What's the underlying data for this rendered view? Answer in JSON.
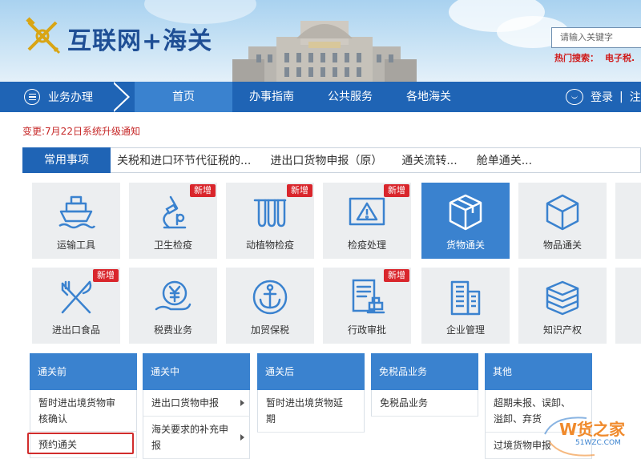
{
  "header": {
    "site_title": "互联网+海关",
    "search_placeholder": "请输入关键字",
    "hot_search_label": "热门搜索：",
    "hot_search_keyword": "电子税."
  },
  "nav": {
    "business_label": "业务办理",
    "items": [
      {
        "label": "首页",
        "active": true
      },
      {
        "label": "办事指南",
        "active": false
      },
      {
        "label": "公共服务",
        "active": false
      },
      {
        "label": "各地海关",
        "active": false
      }
    ],
    "login_label": "登录",
    "separator": "|",
    "register_label": "注"
  },
  "notice": "变更:7月22日系统升级通知",
  "tabbar": {
    "active_label": "常用事项",
    "links": [
      "关税和进口环节代征税的...",
      "进出口货物申报（原）",
      "通关流转...",
      "舱单通关..."
    ]
  },
  "tiles": [
    {
      "label": "运输工具",
      "icon": "ship-icon",
      "badge": ""
    },
    {
      "label": "卫生检疫",
      "icon": "microscope-icon",
      "badge": "新增"
    },
    {
      "label": "动植物检疫",
      "icon": "test-tubes-icon",
      "badge": "新增"
    },
    {
      "label": "检疫处理",
      "icon": "warning-sign-icon",
      "badge": "新增"
    },
    {
      "label": "货物通关",
      "icon": "cargo-box-icon",
      "badge": "",
      "active": true
    },
    {
      "label": "物品通关",
      "icon": "cube-icon",
      "badge": ""
    },
    {
      "label": "进出口食品",
      "icon": "fork-knife-icon",
      "badge": "新增"
    },
    {
      "label": "税费业务",
      "icon": "yuan-coin-hand-icon",
      "badge": ""
    },
    {
      "label": "加贸保税",
      "icon": "anchor-icon",
      "badge": ""
    },
    {
      "label": "行政审批",
      "icon": "document-stamp-icon",
      "badge": "新增"
    },
    {
      "label": "企业管理",
      "icon": "building-icon",
      "badge": ""
    },
    {
      "label": "知识产权",
      "icon": "books-icon",
      "badge": ""
    }
  ],
  "columns": [
    {
      "title": "通关前",
      "items": [
        {
          "label": "暂时进出境货物审核确认",
          "arrow": false
        },
        {
          "label": "预约通关",
          "arrow": false
        }
      ]
    },
    {
      "title": "通关中",
      "items": [
        {
          "label": "进出口货物申报",
          "arrow": true
        },
        {
          "label": "海关要求的补充申报",
          "arrow": true
        }
      ]
    },
    {
      "title": "通关后",
      "items": [
        {
          "label": "暂时进出境货物延期",
          "arrow": false
        }
      ]
    },
    {
      "title": "免税品业务",
      "items": [
        {
          "label": "免税品业务",
          "arrow": false
        }
      ]
    },
    {
      "title": "其他",
      "items": [
        {
          "label": "超期未报、误卸、溢卸、弃货",
          "arrow": false
        },
        {
          "label": "过境货物申报",
          "arrow": false
        }
      ]
    }
  ],
  "watermark": {
    "text": "W货之家",
    "url": "51WZC.COM"
  },
  "colors": {
    "primary": "#1f64b5",
    "accent": "#3a82cf",
    "badge": "#d9262c",
    "notice": "#c62828",
    "tile_bg": "#eceef0"
  }
}
